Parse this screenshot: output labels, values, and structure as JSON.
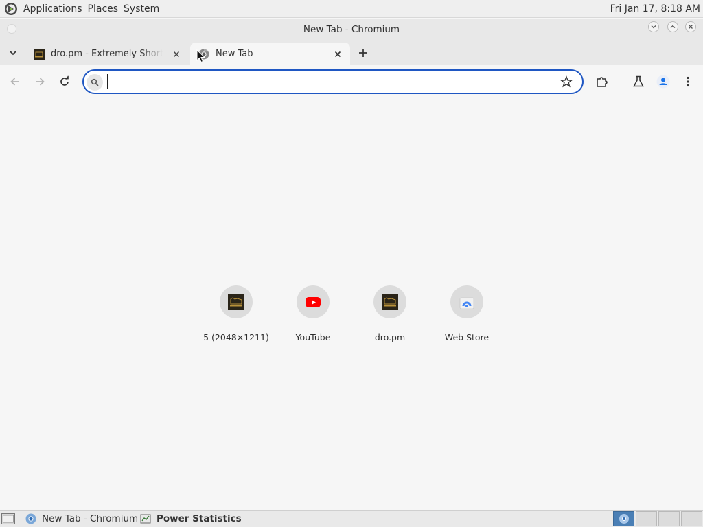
{
  "top_panel": {
    "menus": [
      "Applications",
      "Places",
      "System"
    ],
    "clock": "Fri Jan 17,  8:18 AM"
  },
  "window": {
    "title": "New Tab - Chromium"
  },
  "tabs": [
    {
      "title": "dro.pm - Extremely Short Lin",
      "active": false
    },
    {
      "title": "New Tab",
      "active": true
    }
  ],
  "omnibox": {
    "value": "",
    "placeholder": ""
  },
  "shortcuts": [
    {
      "label": "5 (2048×1211)",
      "icon": "dro-pm-favicon"
    },
    {
      "label": "YouTube",
      "icon": "youtube-icon"
    },
    {
      "label": "dro.pm",
      "icon": "dro-pm-favicon"
    },
    {
      "label": "Web Store",
      "icon": "web-store-icon"
    }
  ],
  "taskbar": {
    "items": [
      {
        "label": "New Tab - Chromium",
        "icon": "chromium-icon",
        "bold": false
      },
      {
        "label": "Power Statistics",
        "icon": "power-statistics-icon",
        "bold": true
      }
    ],
    "workspaces": 4,
    "current_workspace": 1
  },
  "colors": {
    "accent": "#1f57c3",
    "panel_bg": "#efefef",
    "window_bg": "#e8e8e8",
    "content_bg": "#f6f6f6",
    "youtube_red": "#ff0000",
    "profile_blue": "#1a73e8"
  }
}
